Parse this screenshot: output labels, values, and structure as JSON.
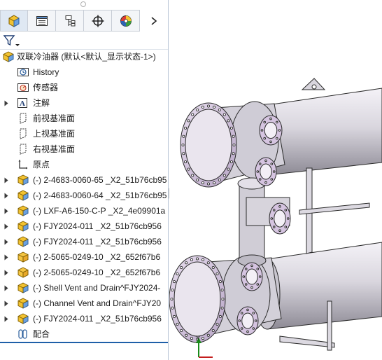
{
  "panel_tabs": [
    {
      "name": "feature-manager-tab",
      "icon": "feature-manager-icon"
    },
    {
      "name": "property-manager-tab",
      "icon": "property-manager-icon"
    },
    {
      "name": "configuration-manager-tab",
      "icon": "configuration-manager-icon"
    },
    {
      "name": "dimxpert-manager-tab",
      "icon": "dimxpert-icon"
    },
    {
      "name": "display-manager-tab",
      "icon": "display-manager-icon"
    }
  ],
  "tree": {
    "root_label": "双联冷油器  (默认<默认_显示状态-1>)",
    "items": [
      {
        "label": "History",
        "icon": "history-icon",
        "expandable": false
      },
      {
        "label": "传感器",
        "icon": "sensor-icon",
        "expandable": false
      },
      {
        "label": "注解",
        "icon": "annotation-icon",
        "expandable": true
      },
      {
        "label": "前视基准面",
        "icon": "plane-icon",
        "expandable": false
      },
      {
        "label": "上视基准面",
        "icon": "plane-icon",
        "expandable": false
      },
      {
        "label": "右视基准面",
        "icon": "plane-icon",
        "expandable": false
      },
      {
        "label": "原点",
        "icon": "origin-icon",
        "expandable": false
      },
      {
        "label": "(-) 2-4683-0060-65 _X2_51b76cb95",
        "icon": "subassembly-icon",
        "expandable": true
      },
      {
        "label": "(-) 2-4683-0060-64 _X2_51b76cb95",
        "icon": "subassembly-icon",
        "expandable": true
      },
      {
        "label": "(-) LXF-A6-150-C-P _X2_4e09901a",
        "icon": "subassembly-icon",
        "expandable": true
      },
      {
        "label": "(-) FJY2024-011 _X2_51b76cb956",
        "icon": "subassembly-icon",
        "expandable": true
      },
      {
        "label": "(-) FJY2024-011 _X2_51b76cb956",
        "icon": "subassembly-icon",
        "expandable": true
      },
      {
        "label": "(-) 2-5065-0249-10 _X2_652f67b6",
        "icon": "part-icon",
        "expandable": true
      },
      {
        "label": "(-) 2-5065-0249-10 _X2_652f67b6",
        "icon": "part-icon",
        "expandable": true
      },
      {
        "label": "(-) Shell Vent and Drain^FJY2024-",
        "icon": "subassembly-icon",
        "expandable": true
      },
      {
        "label": "(-) Channel Vent and Drain^FJY20",
        "icon": "subassembly-icon",
        "expandable": true
      },
      {
        "label": "(-) FJY2024-011 _X2_51b76cb956",
        "icon": "subassembly-icon",
        "expandable": true
      },
      {
        "label": "配合",
        "icon": "mates-icon",
        "expandable": false
      }
    ]
  },
  "viewport": {
    "axis_label": "Y",
    "model": "duplex-oil-cooler"
  },
  "colors": {
    "accent": "#1e5fa8",
    "model_body": "#d6d3dc",
    "model_flange": "#cbb7d6",
    "model_edges": "#2a2a2a"
  }
}
